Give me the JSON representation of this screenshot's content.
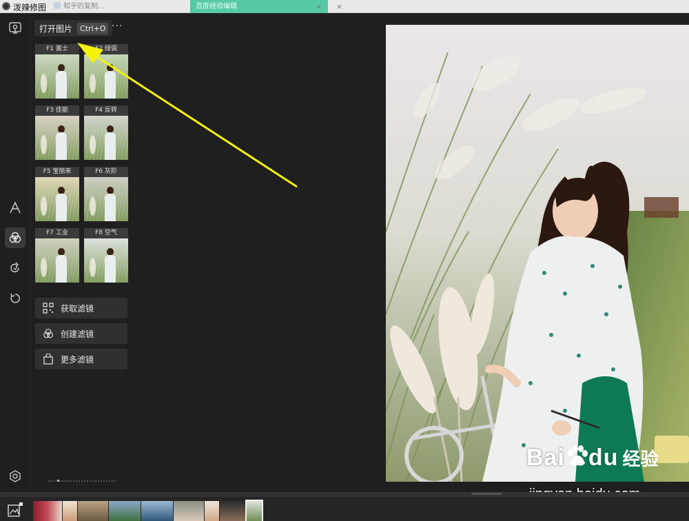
{
  "titlebar": {
    "app_title": "泼辣修图",
    "bg_tab_1": "知乎的复制...",
    "bg_tab_2": "百度经验编辑",
    "close_glyph": "×"
  },
  "toolbar": {
    "tooltip_label": "打开图片",
    "tooltip_shortcut": "Ctrl+O",
    "more_label": "···"
  },
  "filters": [
    {
      "label": "F1 富士",
      "tint": "#cdd9c4"
    },
    {
      "label": "F2 绿调",
      "tint": "#c7d8b8"
    },
    {
      "label": "F3 佳能",
      "tint": "#d9d3c4"
    },
    {
      "label": "F4 反转",
      "tint": "#d2d6cf"
    },
    {
      "label": "F5 宝丽来",
      "tint": "#dfd6b7"
    },
    {
      "label": "F6 灰阶",
      "tint": "#cfcfc6"
    },
    {
      "label": "F7 工业",
      "tint": "#d0d2c2"
    },
    {
      "label": "F8 空气",
      "tint": "#dde3dd"
    }
  ],
  "filter_actions": {
    "get": "获取滤镜",
    "create": "创建滤镜",
    "more": "更多滤镜"
  },
  "sidebar_icons": [
    "open-image-icon",
    "text-icon",
    "filter-icon",
    "redo-icon",
    "undo-icon",
    "settings-icon"
  ],
  "watermark": {
    "brand": "Bai",
    "brand_tail": "du",
    "cn": "经验",
    "url": "jingyan.baidu.com"
  },
  "colors": {
    "background": "#1f1f1f",
    "panel_button": "#303030",
    "arrow": "#f5f20a",
    "active_icon_bg": "#3a3a3a"
  }
}
